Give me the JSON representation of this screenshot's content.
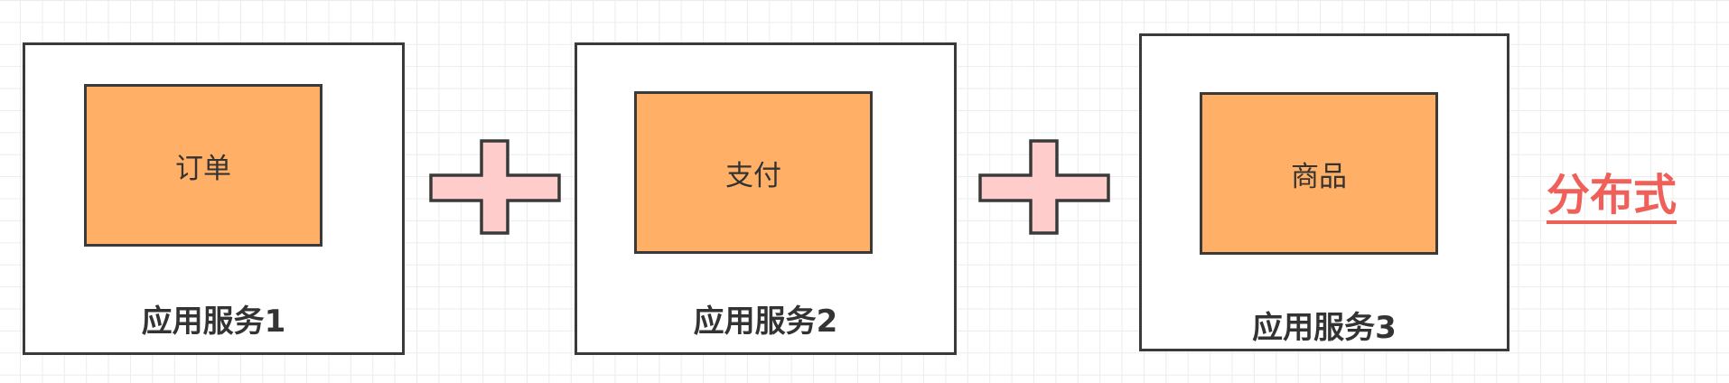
{
  "diagram": {
    "services": [
      {
        "label": "应用服务1",
        "module": "订单"
      },
      {
        "label": "应用服务2",
        "module": "支付"
      },
      {
        "label": "应用服务3",
        "module": "商品"
      }
    ],
    "conclusion": "分布式"
  },
  "colors": {
    "module_fill": "#ffb066",
    "plus_fill": "#ffcccc",
    "stroke": "#3a3a3a",
    "conclusion": "#f0605a"
  }
}
